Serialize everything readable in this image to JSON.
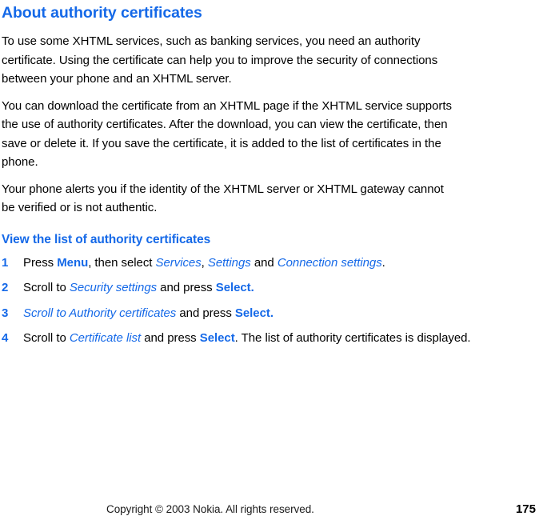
{
  "page": {
    "accent_color": "#1569e8",
    "text_color": "#000000",
    "background_color": "#ffffff"
  },
  "heading": "About authority certificates",
  "paragraphs": [
    "To use some XHTML services, such as banking services, you need an authority certificate. Using the certificate can help you to improve the security of connections between your phone and an XHTML server.",
    "You can download the certificate from an XHTML page if the XHTML service supports the use of authority certificates. After the download, you can view the certificate, then save or delete it. If you save the certificate, it is added to the list of certificates in the phone.",
    "Your phone alerts you if the identity of the XHTML server or XHTML gateway cannot be verified or is not authentic."
  ],
  "subheading": "View the list of authority certificates",
  "steps": [
    {
      "number": "1",
      "runs": {
        "a": "Press ",
        "b": "Menu",
        "c": ", then select ",
        "d": "Services",
        "e": ", ",
        "f": "Settings",
        "g": " and ",
        "h": "Connection settings",
        "i": "."
      }
    },
    {
      "number": "2",
      "runs": {
        "a": "Scroll to ",
        "b": "Security settings",
        "c": " and press ",
        "d": "Select."
      }
    },
    {
      "number": "3",
      "runs": {
        "a": "Scroll to Authority certificates",
        "b": " and press ",
        "c": "Select."
      }
    },
    {
      "number": "4",
      "runs": {
        "a": "Scroll to ",
        "b": "Certificate list",
        "c": " and press ",
        "d": "Select",
        "e": ". The list of authority certificates is displayed."
      }
    }
  ],
  "footer": {
    "copyright": "Copyright © 2003 Nokia. All rights reserved.",
    "page_number": "175"
  }
}
